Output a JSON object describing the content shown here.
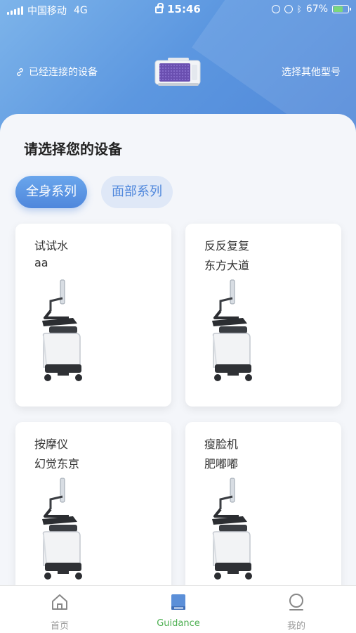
{
  "status_bar": {
    "carrier": "中国移动",
    "network": "4G",
    "time": "15:46",
    "battery": "67%",
    "battery_level": 0.67
  },
  "header": {
    "connected_label": "已经连接的设备",
    "other_model_label": "选择其他型号"
  },
  "main": {
    "title": "请选择您的设备",
    "tabs": [
      {
        "label": "全身系列",
        "active": true
      },
      {
        "label": "面部系列",
        "active": false
      }
    ],
    "cards": [
      {
        "name": "试试水",
        "sub": "aa"
      },
      {
        "name": "反反复复",
        "sub": "东方大道"
      },
      {
        "name": "按摩仪",
        "sub": "幻觉东京"
      },
      {
        "name": "瘦脸机",
        "sub": "肥嘟嘟"
      }
    ]
  },
  "tabbar": {
    "items": [
      {
        "label": "首页",
        "icon": "home-icon",
        "active": false
      },
      {
        "label": "Guidance",
        "icon": "book-icon",
        "active": true
      },
      {
        "label": "我的",
        "icon": "profile-icon",
        "active": false
      }
    ]
  },
  "colors": {
    "accent": "#4f87dc",
    "active_tab": "#4caf50"
  }
}
